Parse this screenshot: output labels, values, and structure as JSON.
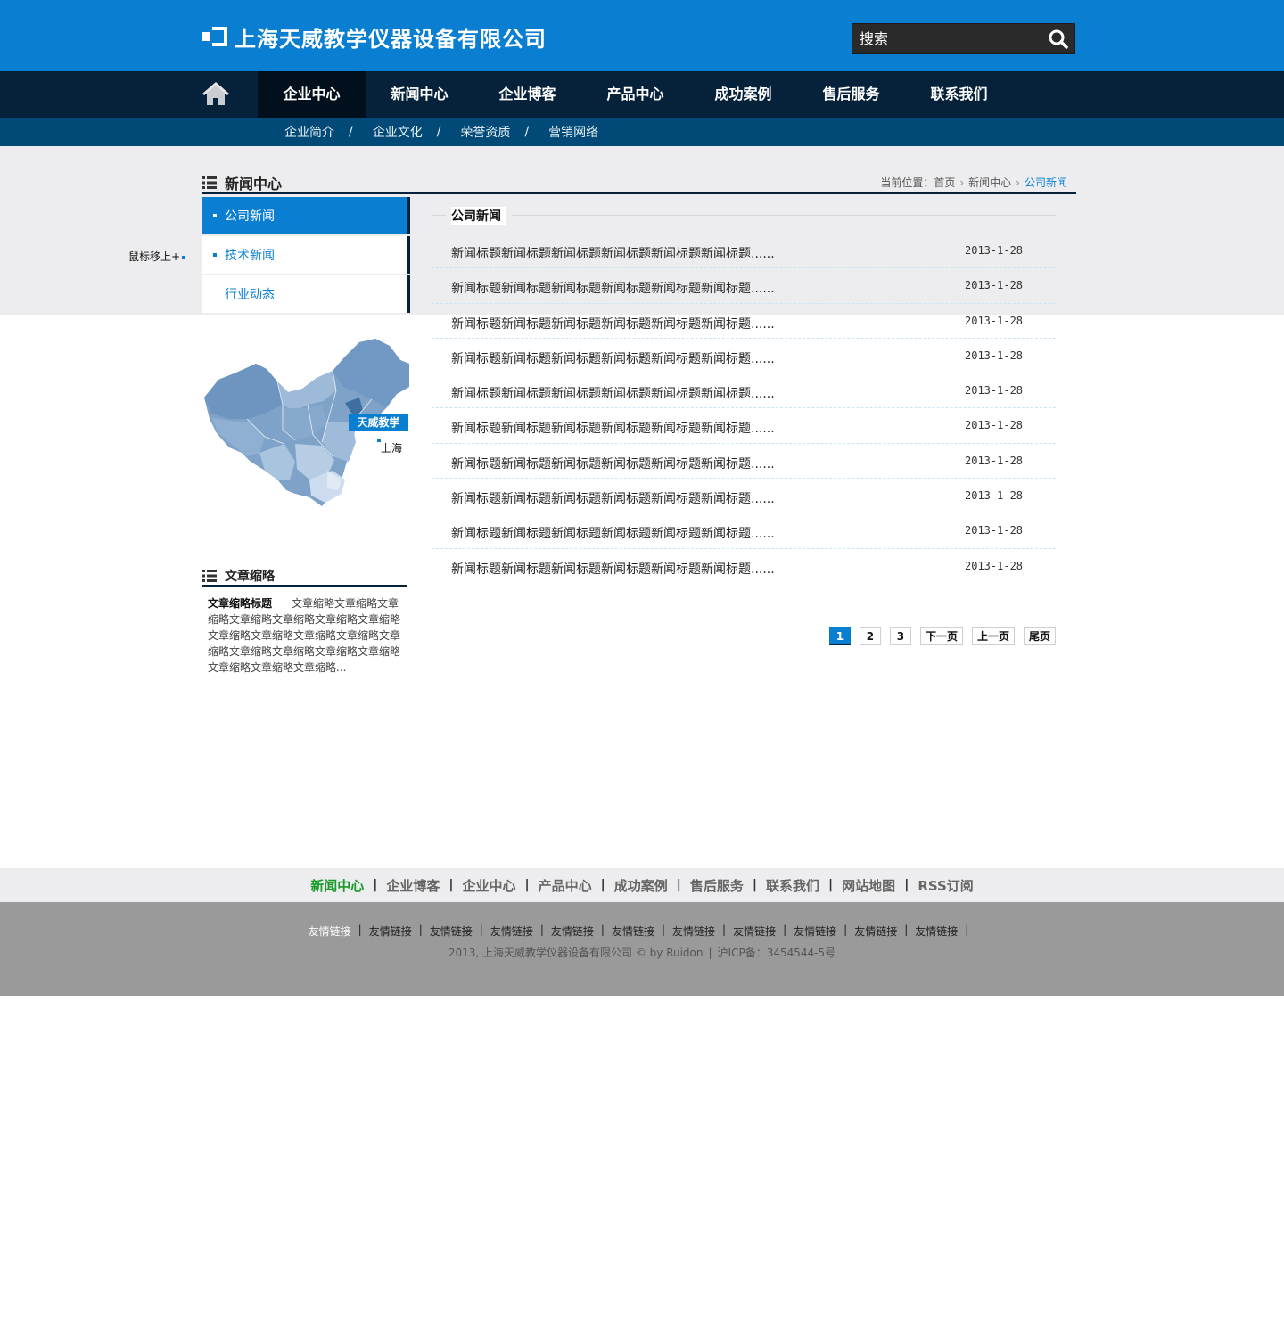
{
  "brand": {
    "name": "上海天威教学仪器设备有限公司"
  },
  "search": {
    "placeholder": "搜索"
  },
  "nav": {
    "items": [
      {
        "label": "企业中心",
        "active": true
      },
      {
        "label": "新闻中心"
      },
      {
        "label": "企业博客"
      },
      {
        "label": "产品中心"
      },
      {
        "label": "成功案例"
      },
      {
        "label": "售后服务"
      },
      {
        "label": "联系我们"
      }
    ]
  },
  "subnav": {
    "items": [
      "企业简介",
      "企业文化",
      "荣誉资质",
      "营销网络"
    ],
    "separator": "/"
  },
  "hover_tip": "鼠标移上+",
  "section": {
    "title": "新闻中心"
  },
  "breadcrumb": {
    "prefix": "当前位置：",
    "items": [
      "首页",
      "新闻中心",
      "公司新闻"
    ]
  },
  "sidebar": {
    "items": [
      {
        "label": "公司新闻",
        "active": true
      },
      {
        "label": "技术新闻"
      },
      {
        "label": "行业动态"
      }
    ]
  },
  "map": {
    "badge": "天威教学",
    "city": "上海"
  },
  "summary": {
    "heading": "文章缩略",
    "title": "文章缩略标题",
    "body": "文章缩略文章缩略文章缩略文章缩略文章缩略文章缩略文章缩略文章缩略文章缩略文章缩略文章缩略文章缩略文章缩略文章缩略文章缩略文章缩略文章缩略文章缩略文章缩略..."
  },
  "news": {
    "title": "公司新闻",
    "rows": [
      {
        "title": "新闻标题新闻标题新闻标题新闻标题新闻标题新闻标题......",
        "date": "2013-1-28"
      },
      {
        "title": "新闻标题新闻标题新闻标题新闻标题新闻标题新闻标题......",
        "date": "2013-1-28"
      },
      {
        "title": "新闻标题新闻标题新闻标题新闻标题新闻标题新闻标题......",
        "date": "2013-1-28"
      },
      {
        "title": "新闻标题新闻标题新闻标题新闻标题新闻标题新闻标题......",
        "date": "2013-1-28"
      },
      {
        "title": "新闻标题新闻标题新闻标题新闻标题新闻标题新闻标题......",
        "date": "2013-1-28"
      },
      {
        "title": "新闻标题新闻标题新闻标题新闻标题新闻标题新闻标题......",
        "date": "2013-1-28"
      },
      {
        "title": "新闻标题新闻标题新闻标题新闻标题新闻标题新闻标题......",
        "date": "2013-1-28"
      },
      {
        "title": "新闻标题新闻标题新闻标题新闻标题新闻标题新闻标题......",
        "date": "2013-1-28"
      },
      {
        "title": "新闻标题新闻标题新闻标题新闻标题新闻标题新闻标题......",
        "date": "2013-1-28"
      },
      {
        "title": "新闻标题新闻标题新闻标题新闻标题新闻标题新闻标题......",
        "date": "2013-1-28"
      }
    ]
  },
  "pager": {
    "pages": [
      "1",
      "2",
      "3"
    ],
    "current": "1",
    "next": "下一页",
    "prev": "上一页",
    "last": "尾页"
  },
  "footer_nav": {
    "items": [
      {
        "label": "新闻中心",
        "active": true
      },
      {
        "label": "企业博客"
      },
      {
        "label": "企业中心"
      },
      {
        "label": "产品中心"
      },
      {
        "label": "成功案例"
      },
      {
        "label": "售后服务"
      },
      {
        "label": "联系我们"
      },
      {
        "label": "网站地图"
      },
      {
        "label": "RSS订阅"
      }
    ]
  },
  "friend_links": [
    "友情链接",
    "友情链接",
    "友情链接",
    "友情链接",
    "友情链接",
    "友情链接",
    "友情链接",
    "友情链接",
    "友情链接",
    "友情链接",
    "友情链接"
  ],
  "copyright": {
    "text": "2013, 上海天威教学仪器设备有限公司 © by Ruidon",
    "icp": "沪ICP备：3454544-5号"
  },
  "colors": {
    "brand_blue": "#0a7fd1",
    "nav_dark": "#06223a",
    "subnav_blue": "#014a78",
    "footer_active_green": "#1a9a2a"
  }
}
